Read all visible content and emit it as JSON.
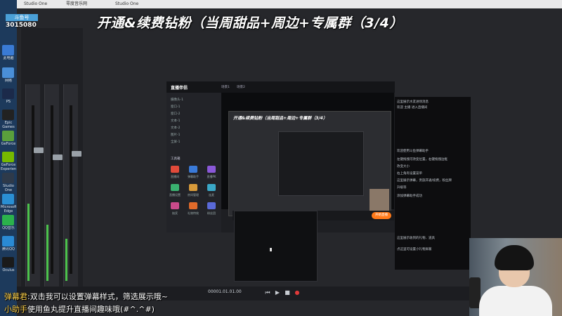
{
  "headline": "开通&续费钻粉（当周甜品+周边+专属群（3/4）",
  "room": {
    "badge": "斗鱼号",
    "number": "3015080"
  },
  "topbar": {
    "items": [
      "Studio One",
      "零度音乐网",
      "Studio One"
    ]
  },
  "desktop_icons": [
    {
      "label": "此电脑",
      "color": "#3a7bd5"
    },
    {
      "label": "网络",
      "color": "#4a8fd8"
    },
    {
      "label": "PS",
      "color": "#1b2a4a"
    },
    {
      "label": "Epic Games",
      "color": "#222222"
    },
    {
      "label": "GeForce",
      "color": "#5aa03c"
    },
    {
      "label": "GeForce Experience",
      "color": "#76b900"
    },
    {
      "label": "Studio One",
      "color": "#2e3a4a"
    },
    {
      "label": "Microsoft Edge",
      "color": "#2a8fd3"
    },
    {
      "label": "QQ音乐",
      "color": "#2bb24c"
    },
    {
      "label": "腾讯QQ",
      "color": "#2a8ad4"
    },
    {
      "label": "Oculus",
      "color": "#1a1a1a"
    }
  ],
  "broadcast": {
    "title": "直播伴侣",
    "tabs": [
      "场景1",
      "场景2"
    ],
    "sources": [
      "摄像头-1",
      "窗口-1",
      "窗口-2",
      "文本-1",
      "文本-2",
      "图片-1",
      "全屏-1"
    ],
    "tools_label": "工具箱",
    "tools": [
      {
        "label": "直播间",
        "color": "#e04a3a"
      },
      {
        "label": "弹幕助手",
        "color": "#3a7ad8"
      },
      {
        "label": "直播PK",
        "color": "#8a58d8"
      },
      {
        "label": "直播设置",
        "color": "#3ab070"
      },
      {
        "label": "房间管理",
        "color": "#d89a3a"
      },
      {
        "label": "连麦",
        "color": "#3aa8c8"
      },
      {
        "label": "抽奖",
        "color": "#c84a8a"
      },
      {
        "label": "礼物特效",
        "color": "#e06a2a"
      },
      {
        "label": "粉丝团",
        "color": "#5a6ad8"
      }
    ],
    "preview_title": "开通&续费钻粉（当周甜品+周边+专属群（3/4）",
    "start_button": "开始直播"
  },
  "chat": {
    "lines": [
      "这里展示水友进场消息",
      "欢迎 主播 进入直播间",
      "欢迎使用斗鱼弹幕助手",
      "左键拖拽可改变位置，右键拖拽边框",
      "改变大小",
      "右上角有设置菜单",
      "这里展示弹幕，贵族开通/续费，粉丝牌",
      "升级等",
      "添加弹幕助手成功",
      "这里展示收到的礼物、道具",
      "点这里可设置小礼物屏蔽"
    ]
  },
  "transport": {
    "timecode": "00001.01.01.00"
  },
  "danmaku": [
    {
      "name": "弹幕君",
      "text": ":双击我可以设置弹幕样式，筛选展示哦~"
    },
    {
      "name": "小助手",
      "text": "使用鱼丸提升直播间趣味哦(#^.^#)"
    }
  ]
}
